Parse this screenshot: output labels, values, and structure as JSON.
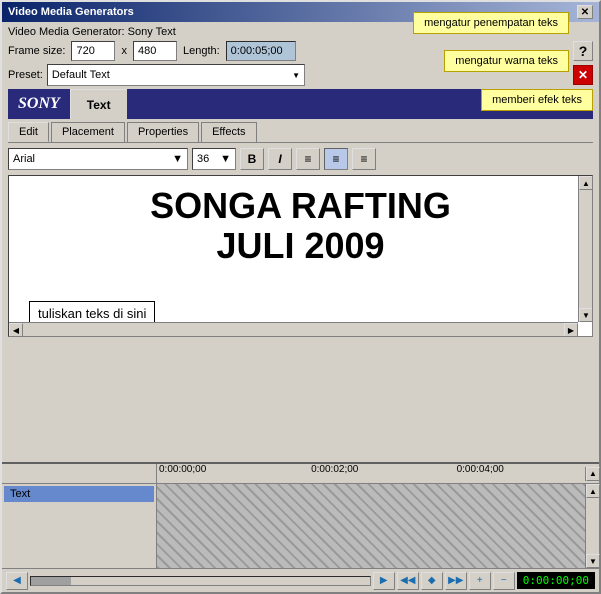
{
  "window": {
    "title": "Video Media Generators",
    "close_icon": "✕"
  },
  "header": {
    "generator_label": "Video Media Generator:",
    "generator_name": "Sony Text",
    "frame_size_label": "Frame size:",
    "width": "720",
    "x_separator": "x",
    "height": "480",
    "length_label": "Length:",
    "length_value": "0:00:05;00",
    "question": "?"
  },
  "preset": {
    "label": "Preset:",
    "value": "Default Text",
    "close_icon": "✕"
  },
  "sony_panel": {
    "logo": "SONY",
    "tab": "Text"
  },
  "tabs": {
    "items": [
      {
        "label": "Edit",
        "active": true
      },
      {
        "label": "Placement",
        "active": false
      },
      {
        "label": "Properties",
        "active": false
      },
      {
        "label": "Effects",
        "active": false
      }
    ]
  },
  "toolbar": {
    "font": "Arial",
    "size": "36",
    "bold": "B",
    "italic": "I",
    "align_left": "≡",
    "align_center": "≡",
    "align_right": "≡"
  },
  "canvas": {
    "main_line1": "SONGA RAFTING",
    "main_line2": "JULI 2009",
    "sub_text": "tuliskan teks di sini"
  },
  "callouts": {
    "placement": "mengatur penempatan teks",
    "color": "mengatur warna teks",
    "effect": "memberi efek teks"
  },
  "timeline": {
    "track_label": "Text",
    "time_markers": [
      "0:00:00;00",
      "0:00:02;00",
      "0:00:04;00"
    ],
    "time_display": "0:00:00;00"
  },
  "transport": {
    "buttons": [
      "▲",
      "◀",
      "◆",
      "▶",
      "▶"
    ]
  }
}
